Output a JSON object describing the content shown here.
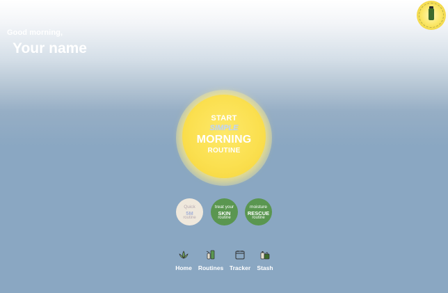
{
  "header": {
    "greeting": "Good morning,",
    "name": "Your name"
  },
  "logo": {
    "icon": "bottle-logo-icon"
  },
  "start_button": {
    "line1": "START",
    "line2": "SIMPLE",
    "line3": "MORNING",
    "line4": "ROUTINE",
    "color": "#fbe050"
  },
  "routines": [
    {
      "top": "Quick",
      "mid": "5M",
      "bottom": "routine",
      "color": "#efe8dc"
    },
    {
      "top": "treat your",
      "mid": "SKIN",
      "bottom": "routine",
      "color": "#5a9650"
    },
    {
      "top": "moisture",
      "mid": "RESCUE",
      "bottom": "routine",
      "color": "#5a9650"
    }
  ],
  "nav": [
    {
      "label": "Home",
      "icon": "lotus-icon"
    },
    {
      "label": "Routines",
      "icon": "products-icon"
    },
    {
      "label": "Tracker",
      "icon": "calendar-icon"
    },
    {
      "label": "Stash",
      "icon": "bag-icon"
    }
  ]
}
